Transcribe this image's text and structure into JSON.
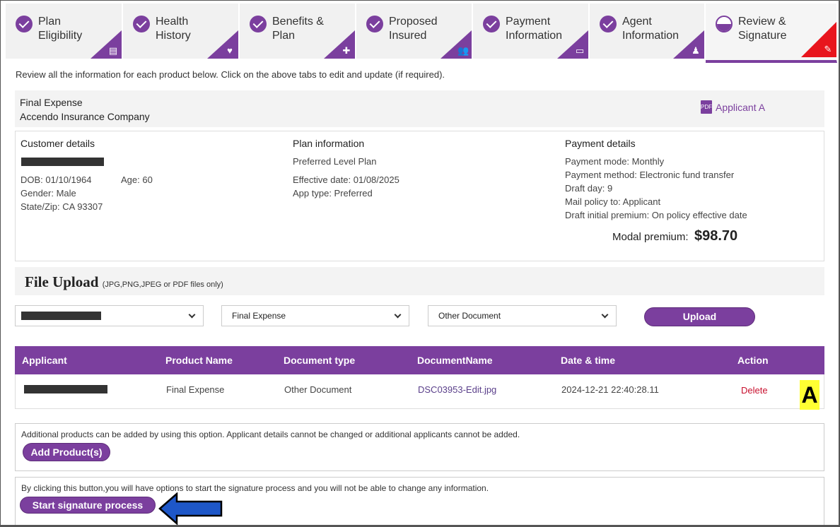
{
  "tabs": [
    {
      "line1": "Plan",
      "line2": "Eligibility",
      "icon": "document-icon"
    },
    {
      "line1": "Health",
      "line2": "History",
      "icon": "heart-pulse-icon"
    },
    {
      "line1": "Benefits &",
      "line2": "Plan",
      "icon": "medical-kit-icon"
    },
    {
      "line1": "Proposed",
      "line2": "Insured",
      "icon": "people-icon"
    },
    {
      "line1": "Payment",
      "line2": "Information",
      "icon": "card-icon"
    },
    {
      "line1": "Agent",
      "line2": "Information",
      "icon": "agent-icon"
    },
    {
      "line1": "Review &",
      "line2": "Signature",
      "icon": "signature-icon"
    }
  ],
  "intro": "Review all the information for each product below. Click on the above tabs to edit and update (if required).",
  "product": {
    "name": "Final Expense",
    "company": "Accendo Insurance Company",
    "applicant_link": "Applicant A"
  },
  "customer": {
    "heading": "Customer details",
    "dob": "DOB: 01/10/1964",
    "age": "Age: 60",
    "gender": "Gender: Male",
    "state_zip": "State/Zip: CA 93307"
  },
  "plan": {
    "heading": "Plan information",
    "name": "Preferred Level Plan",
    "effective": "Effective date: 01/08/2025",
    "app_type": "App type: Preferred"
  },
  "payment": {
    "heading": "Payment details",
    "mode": "Payment mode: Monthly",
    "method": "Payment method: Electronic fund transfer",
    "draft_day": "Draft day: 9",
    "mail_policy": "Mail policy to: Applicant",
    "draft_initial": "Draft initial premium: On policy effective date",
    "modal_label": "Modal premium:",
    "modal_value": "$98.70"
  },
  "upload": {
    "title": "File Upload",
    "note": "(JPG,PNG,JPEG or PDF files only)",
    "product_select": "Final Expense",
    "doctype_select": "Other Document",
    "button": "Upload"
  },
  "table": {
    "headers": [
      "Applicant",
      "Product Name",
      "Document type",
      "DocumentName",
      "Date & time",
      "Action"
    ],
    "row": {
      "product": "Final Expense",
      "doctype": "Other Document",
      "docname": "DSC03953-Edit.jpg",
      "datetime": "2024-12-21 22:40:28.11",
      "action": "Delete"
    }
  },
  "add_products": {
    "note": "Additional products can be added by using this option. Applicant details cannot be changed or additional applicants cannot be added.",
    "button": "Add Product(s)"
  },
  "signature": {
    "note": "By clicking this button,you will have options to start the signature process and you will not be able to change any information.",
    "button": "Start signature process"
  },
  "annotation_label": "A",
  "colors": {
    "brand": "#7b3f9e",
    "alert": "#e8151d",
    "delete": "#c8102e",
    "tag": "#ffff33",
    "arrow": "#1e57c8"
  }
}
